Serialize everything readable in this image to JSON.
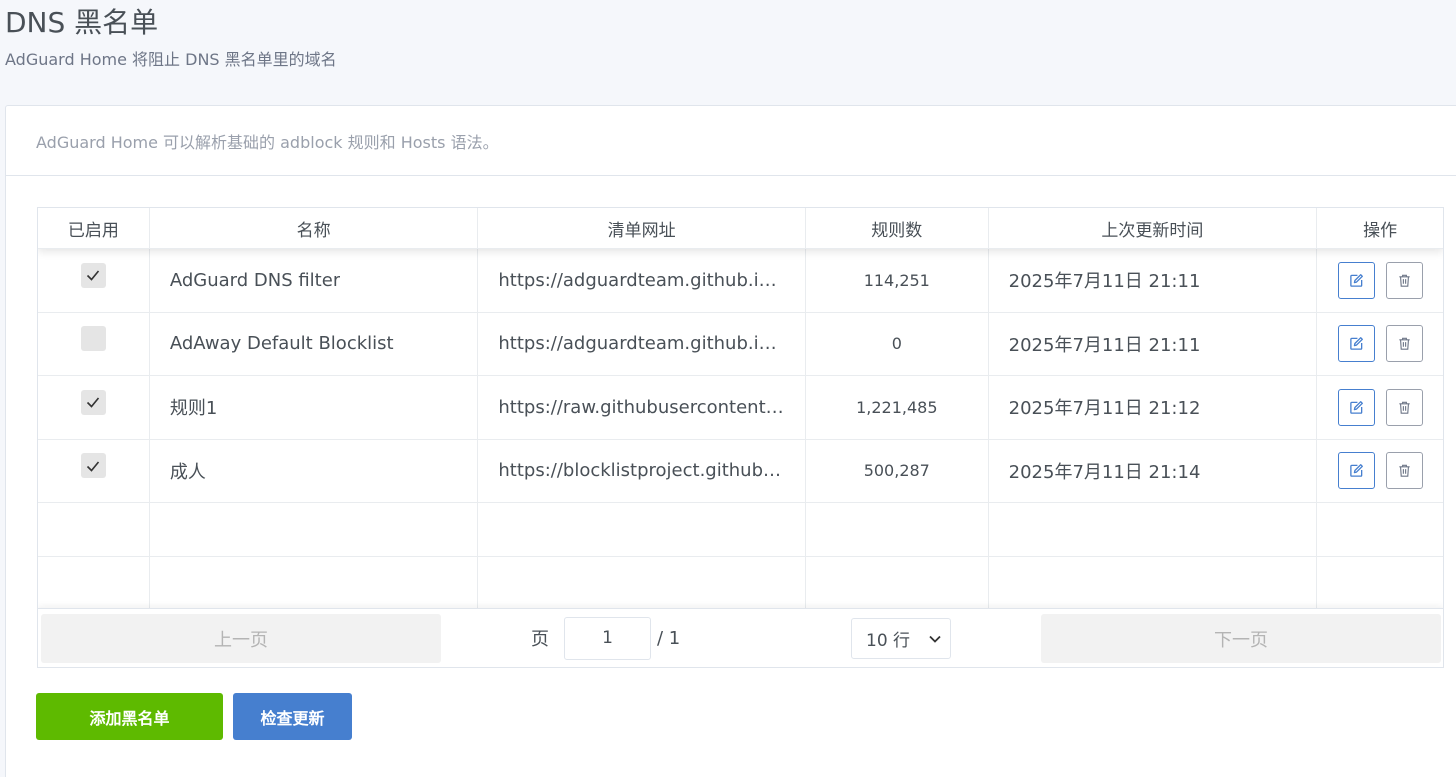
{
  "page": {
    "title": "DNS 黑名单",
    "subtitle": "AdGuard Home 将阻止 DNS 黑名单里的域名"
  },
  "card": {
    "note": "AdGuard Home 可以解析基础的 adblock 规则和 Hosts 语法。"
  },
  "table": {
    "headers": {
      "enabled": "已启用",
      "name": "名称",
      "url": "清单网址",
      "rules": "规则数",
      "updated": "上次更新时间",
      "actions": "操作"
    },
    "rows": [
      {
        "enabled": true,
        "name": "AdGuard DNS filter",
        "url": "https://adguardteam.github.io…",
        "rules": "114,251",
        "updated": "2025年7月11日 21:11"
      },
      {
        "enabled": false,
        "name": "AdAway Default Blocklist",
        "url": "https://adguardteam.github.io…",
        "rules": "0",
        "updated": "2025年7月11日 21:11"
      },
      {
        "enabled": true,
        "name": "规则1",
        "url": "https://raw.githubusercontent.…",
        "rules": "1,221,485",
        "updated": "2025年7月11日 21:12"
      },
      {
        "enabled": true,
        "name": "成人",
        "url": "https://blocklistproject.github.i…",
        "rules": "500,287",
        "updated": "2025年7月11日 21:14"
      }
    ]
  },
  "pagination": {
    "prev_label": "上一页",
    "next_label": "下一页",
    "page_label": "页",
    "current_page": "1",
    "total_pages": "/ 1",
    "rows_per_page": "10 行"
  },
  "buttons": {
    "add_label": "添加黑名单",
    "check_label": "检查更新"
  },
  "colors": {
    "add_button": "#5eba00",
    "check_button": "#467fcf",
    "edit_icon": "#467fcf"
  }
}
